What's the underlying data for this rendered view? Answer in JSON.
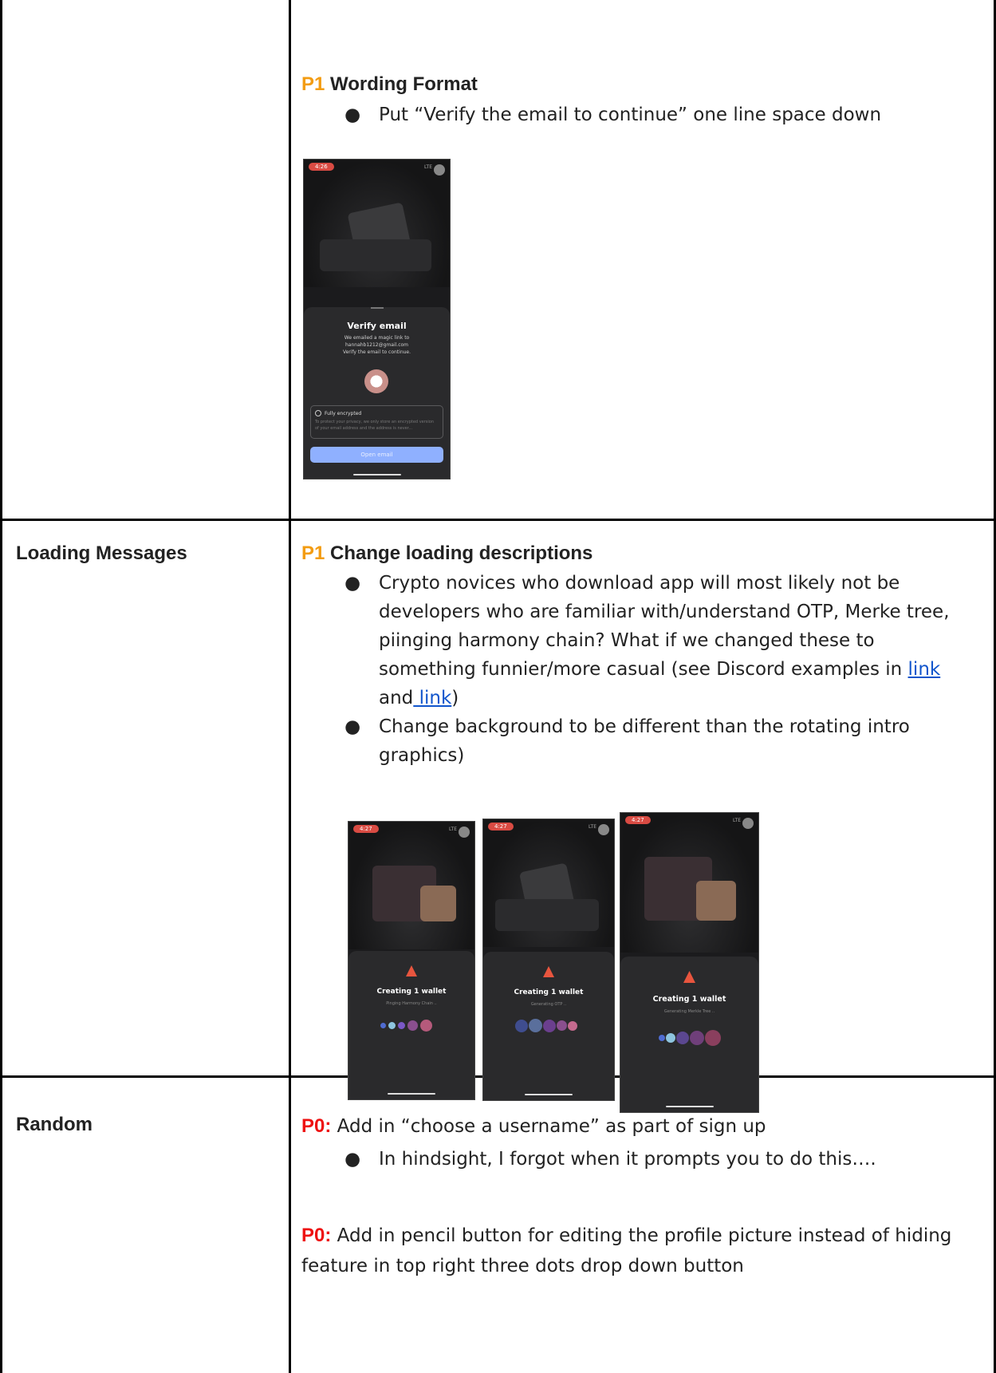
{
  "rows": [
    {
      "label": "",
      "priority": "P1",
      "title": "Wording Format",
      "bullets": [
        "Put “Verify the email to continue” one line space down"
      ]
    },
    {
      "label": "Loading Messages",
      "priority": "P1",
      "title": "Change loading descriptions",
      "bullet1_text": "Crypto novices who download app will most likely not be developers who are familiar with/understand OTP, Merke tree, piinging harmony chain? What if we changed these to something funnier/more casual (see Discord examples in",
      "bullet1_link1": "link",
      "bullet1_and": " and",
      "bullet1_link2": " link",
      "bullet1_close": ")",
      "bullet2_text": "Change background to be different than the rotating intro graphics)"
    },
    {
      "label": "Random",
      "items": [
        {
          "priority": "P0:",
          "text": " Add in “choose a username” as part of sign up",
          "bullet": "In hindsight, I forgot when it prompts you to do this…."
        },
        {
          "priority": "P0:",
          "text": " Add in pencil button for editing the profile picture instead of hiding feature in top right three dots drop down button"
        }
      ]
    }
  ],
  "verify_phone": {
    "time": "4:26",
    "status": "LTE",
    "title": "Verify email",
    "line1": "We emailed a magic link to",
    "line2": "hannahb1212@gmail.com",
    "line3": "Verify the email to continue.",
    "encrypted_label": "Fully encrypted",
    "encrypted_text": "To protect your privacy, we only store an encrypted version of your email address and the address is never...",
    "button": "Open email"
  },
  "loading_phones": [
    {
      "time": "4:27",
      "status": "LTE",
      "title": "Creating 1 wallet",
      "subtitle": "Pinging Harmony Chain .."
    },
    {
      "time": "4:27",
      "status": "LTE",
      "title": "Creating 1 wallet",
      "subtitle": "Generating OTP .."
    },
    {
      "time": "4:27",
      "status": "LTE",
      "title": "Creating 1 wallet",
      "subtitle": "Generating Merkle Tree .."
    }
  ],
  "colors": {
    "p1": "#f39c12",
    "p0": "#ee1111",
    "link": "#1155cc",
    "open_email_button": "#8fb0ff",
    "time_badge": "#d94b43"
  }
}
